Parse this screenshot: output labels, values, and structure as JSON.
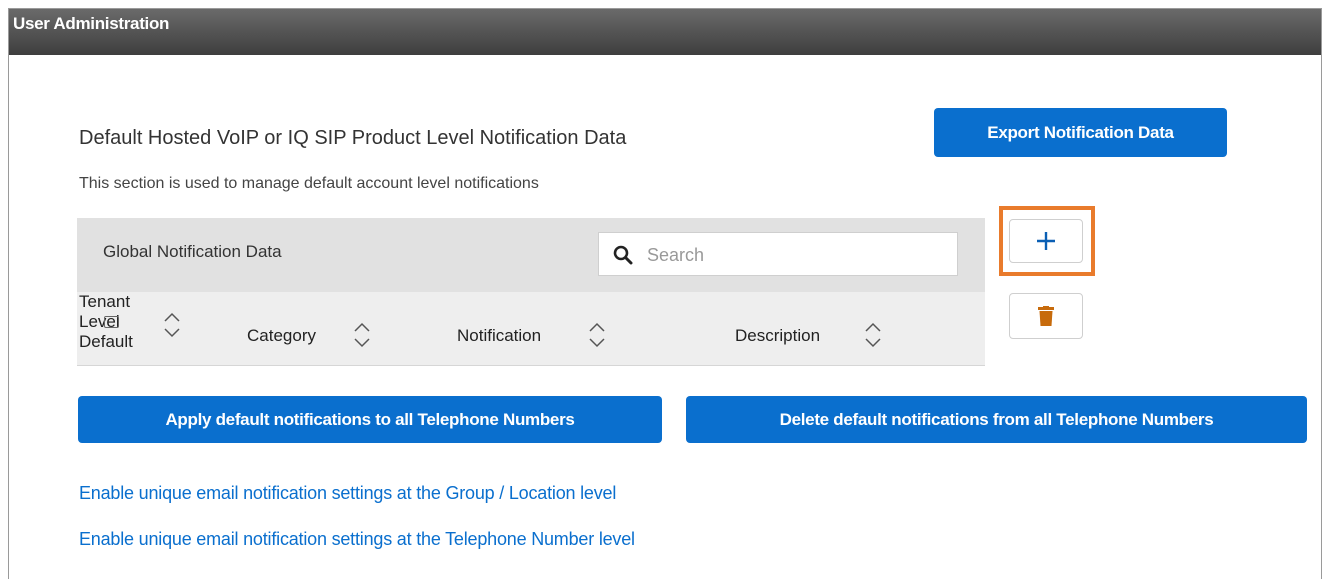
{
  "window": {
    "title": "User Administration"
  },
  "section": {
    "heading": "Default Hosted VoIP or IQ SIP Product Level Notification Data",
    "description": "This section is used to manage default account level notifications",
    "export_button": "Export Notification Data"
  },
  "grid": {
    "title": "Global Notification Data",
    "search": {
      "placeholder": "Search",
      "value": ""
    },
    "columns": [
      {
        "label_lines": [
          "Tenant",
          "Level",
          "Default"
        ]
      },
      {
        "label": "Category"
      },
      {
        "label": "Notification"
      },
      {
        "label": "Description"
      }
    ],
    "rows": []
  },
  "side_actions": {
    "add_icon": "plus-icon",
    "delete_icon": "trash-icon",
    "highlight_color": "#e97b2c",
    "trash_color": "#c76b0c"
  },
  "actions": {
    "apply_button": "Apply default notifications to all Telephone Numbers",
    "delete_button": "Delete default notifications from all Telephone Numbers"
  },
  "links": [
    "Enable unique email notification settings at the Group / Location level",
    "Enable unique email notification settings at the Telephone Number level"
  ],
  "colors": {
    "primary": "#0a6fce",
    "titlebar": "#4a4a4a"
  }
}
